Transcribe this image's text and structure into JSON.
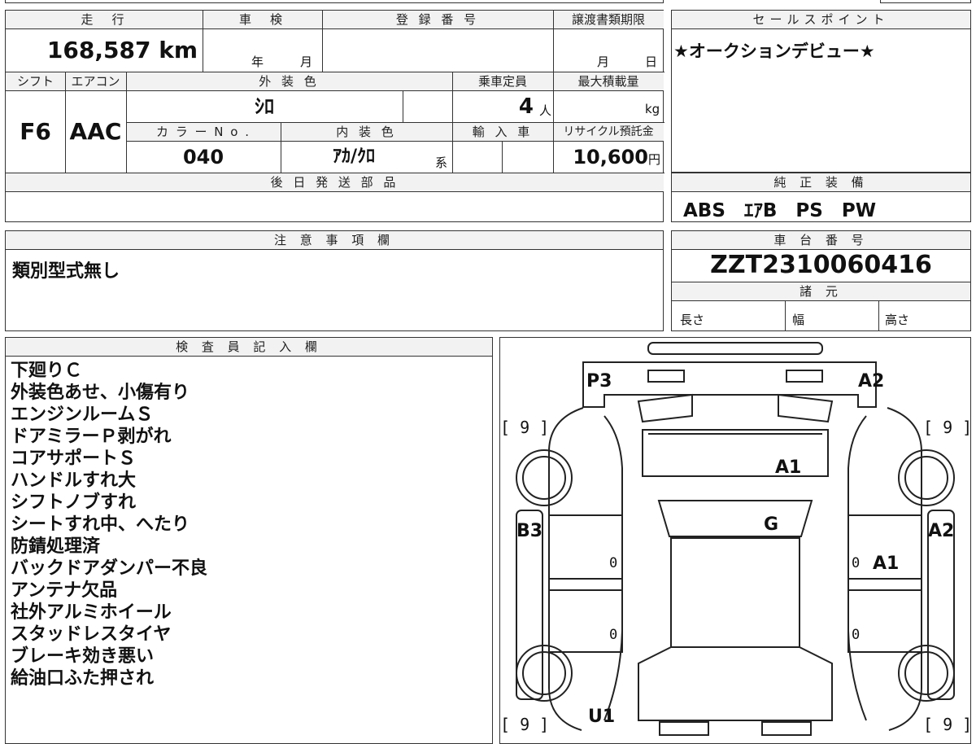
{
  "vehicle": {
    "mileage_label": "走　行",
    "mileage_value": "168,587",
    "mileage_unit": "km",
    "shaken_label": "車　検",
    "shaken_year": "年",
    "shaken_month": "月",
    "reg_label": "登 録 番 号",
    "transfer_label": "譲渡書類期限",
    "transfer_month": "月",
    "transfer_day": "日",
    "shift_label": "シフト",
    "shift_value": "F6",
    "ac_label": "エアコン",
    "ac_value": "AAC",
    "color_label": "外 装 色",
    "color_value": "ｼﾛ",
    "capacity_label": "乗車定員",
    "capacity_value": "4",
    "capacity_unit": "人",
    "maxload_label": "最大積載量",
    "maxload_unit": "kg",
    "colorno_label": "カ ラ ー N o .",
    "colorno_value": "040",
    "interior_label": "内 装 色",
    "interior_value": "ｱｶ/ｸﾛ",
    "interior_suffix": "系",
    "import_label": "輸 入 車",
    "recycle_label": "リサイクル預託金",
    "recycle_value": "10,600",
    "recycle_unit": "円",
    "parts_label": "後 日 発 送 部 品"
  },
  "sales": {
    "label": "セールスポイント",
    "text": "★オークションデビュー★"
  },
  "equipment": {
    "label": "純 正 装 備",
    "text": "ABS　ｴｱB　PS　PW"
  },
  "notes": {
    "label": "注 意 事 項 欄",
    "text": "類別型式無し"
  },
  "chassis": {
    "label": "車 台 番 号",
    "value": "ZZT2310060416",
    "spec_label": "諸 元",
    "length_label": "長さ",
    "width_label": "幅",
    "height_label": "高さ"
  },
  "inspector": {
    "label": "検 査 員 記 入 欄",
    "lines": [
      "下廻りＣ",
      "外装色あせ、小傷有り",
      "エンジンルームＳ",
      "ドアミラーＰ剥がれ",
      "コアサポートＳ",
      "ハンドルすれ大",
      "シフトノブすれ",
      "シートすれ中、へたり",
      "防錆処理済",
      "バックドアダンパー不良",
      "アンテナ欠品",
      "社外アルミホイール",
      "スタッドレスタイヤ",
      "ブレーキ効き悪い",
      "給油口ふた押され"
    ]
  },
  "diagram": {
    "marks": {
      "p3": "P3",
      "a2_top": "A2",
      "a1_hood": "A1",
      "g_glass": "G",
      "b3": "B3",
      "a2_right": "A2",
      "a1_right": "A1",
      "u1": "U1",
      "tire_tl": "[ 9 ]",
      "tire_tr": "[ 9 ]",
      "tire_bl": "[ 9 ]",
      "tire_br": "[ 9 ]",
      "zero_l1": "0",
      "zero_l2": "0",
      "zero_r1": "0",
      "zero_r2": "0"
    }
  }
}
